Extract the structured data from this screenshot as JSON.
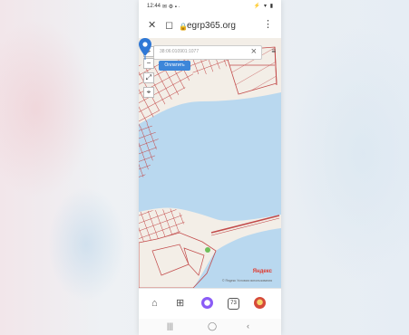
{
  "status_bar": {
    "time": "12:44",
    "left_icons": "✉ ⚙ ▪ ·",
    "right_icons": "⚡ ▾ ▮"
  },
  "browser": {
    "close_icon": "✕",
    "bookmark_icon": "◻",
    "lock_icon": "🔒",
    "url": "egrp365.org",
    "menu_icon": "⋮"
  },
  "map": {
    "search_value": "38:06:010901:1077",
    "clear_icon": "×",
    "find_label": "Оплатить",
    "layers_icon": "≡",
    "zoom_in": "+",
    "zoom_out": "−",
    "fullscreen": "⤢",
    "locate": "⌖",
    "attribution": "Яндекс",
    "copyright": "© Яндекс Условия использования",
    "colors": {
      "water": "#b9d8ef",
      "land": "#f3eee7",
      "parcel_lines": "#c24a4a",
      "pin": "#2f78d6"
    }
  },
  "bottom_nav": {
    "home_icon": "⌂",
    "apps_icon": "⊞",
    "tabs_count": "73"
  },
  "system_nav": {
    "recent": "|||",
    "home": "◯",
    "back": "‹"
  }
}
